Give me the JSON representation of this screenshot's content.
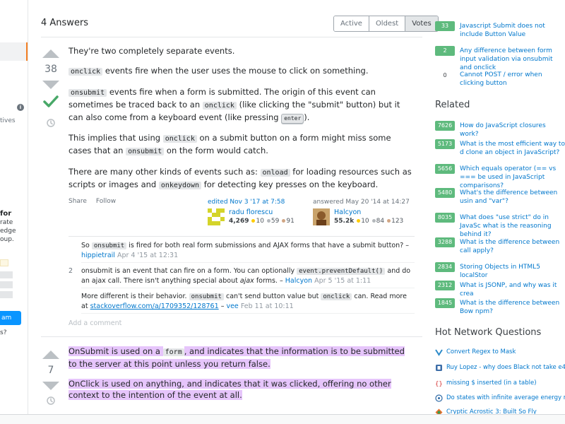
{
  "left_sidebar": {
    "label_tives": "tives",
    "label_for": "for",
    "line_rate": "rate",
    "line_edge": "edge",
    "line_oup": "oup.",
    "button_label": "am",
    "line_s": "s?"
  },
  "answers": {
    "count_label": "4 Answers",
    "sort_tabs": [
      {
        "label": "Active"
      },
      {
        "label": "Oldest"
      },
      {
        "label": "Votes"
      }
    ]
  },
  "answer1": {
    "votes": "38",
    "p1": "They're two completely separate events.",
    "p2_code": "onclick",
    "p2_rest": "events fire when the user uses the mouse to click on something.",
    "p3_code1": "onsubmit",
    "p3_text1": "events fire when a form is submitted. The origin of this event can sometimes be traced back to an",
    "p3_code2": "onclick",
    "p3_text2": "(like clicking the \"submit\" button) but it can also come from a keyboard event (like pressing",
    "p3_kbd": "enter",
    "p3_text3": ").",
    "p4_text1": "This implies that using",
    "p4_code1": "onclick",
    "p4_text2": "on a submit button on a form might miss some cases that an",
    "p4_code2": "onsubmit",
    "p4_text3": "on the form would catch.",
    "p5_text1": "There are many other kinds of events such as:",
    "p5_code1": "onload",
    "p5_text2": "for loading resources such as scripts or images and",
    "p5_code2": "onkeydown",
    "p5_text3": "for detecting key presses on the keyboard.",
    "menu_share": "Share",
    "menu_follow": "Follow",
    "editor": {
      "action": "edited Nov 3 '17 at 7:58",
      "name": "radu florescu",
      "rep": "4,269",
      "gold": "10",
      "silver": "59",
      "bronze": "91"
    },
    "author": {
      "action": "answered May 20 '14 at 14:27",
      "name": "Halcyon",
      "rep": "55.2k",
      "gold": "10",
      "silver": "84",
      "bronze": "123"
    }
  },
  "comments": [
    {
      "score": "",
      "t1": "So",
      "code1": "onsubmit",
      "t2": "is fired for both real form submissions and AJAX forms that have a submit button? –",
      "user": "hippietrail",
      "date": "Apr 4 '15 at 12:31"
    },
    {
      "score": "2",
      "t1": "onsubmit is an event that can fire on a form. You can optionally",
      "code1": "event.preventDefault()",
      "t2": "and do an ajax call. There isn't anything special about",
      "em": "ajax",
      "t3": "forms. –",
      "user": "Halcyon",
      "date": "Apr 5 '15 at 1:11"
    },
    {
      "score": "",
      "t1": "More different is their behavior.",
      "code1": "onsubmit",
      "t2": "can't send button value but",
      "code2": "onclick",
      "t3": "can. Read more at",
      "link": "stackoverflow.com/a/1709352/128761",
      "t4": "–",
      "user": "vee",
      "date": "Feb 11 at 10:11"
    }
  ],
  "add_comment": "Add a comment",
  "answer2": {
    "votes": "7",
    "p1_text1": "OnSubmit is used on a",
    "p1_code": "form",
    "p1_text2": ", and indicates that the information is to be submitted to the server at this point unless you return false.",
    "p2": "OnClick is used on anything, and indicates that it was clicked, offering no other context to the intention of the event at all."
  },
  "sidebar": {
    "linked": [
      {
        "count": "33",
        "text": "Javascript Submit does not include Button Value"
      },
      {
        "count": "2",
        "text": "Any difference between form input validation via onsubmit and onclick"
      },
      {
        "count": "0",
        "text": "Cannot POST / error when clicking button"
      }
    ],
    "related_title": "Related",
    "related": [
      {
        "count": "7626",
        "text": "How do JavaScript closures work?"
      },
      {
        "count": "5173",
        "text": "What is the most efficient way to d clone an object in JavaScript?"
      },
      {
        "count": "5656",
        "text": "Which equals operator (== vs === be used in JavaScript comparisons?"
      },
      {
        "count": "5480",
        "text": "What's the difference between usin and \"var\"?"
      },
      {
        "count": "8035",
        "text": "What does \"use strict\" do in JavaSc what is the reasoning behind it?"
      },
      {
        "count": "3288",
        "text": "What is the difference between call apply?"
      },
      {
        "count": "2834",
        "text": "Storing Objects in HTML5 localStor"
      },
      {
        "count": "2312",
        "text": "What is JSONP, and why was it crea"
      },
      {
        "count": "1845",
        "text": "What is the difference between Bow npm?"
      }
    ],
    "hnq_title": "Hot Network Questions",
    "hnq": [
      {
        "icon": "superuser-icon",
        "text": "Convert Regex to Mask"
      },
      {
        "icon": "chess-icon",
        "text": "Ruy Lopez - why does Black not take e4?"
      },
      {
        "icon": "tex-icon",
        "text": "missing $ inserted (in a table)"
      },
      {
        "icon": "physics-icon",
        "text": "Do states with infinite average energy mak"
      },
      {
        "icon": "puzzling-icon",
        "text": "Cryptic Acrostic 3: Built So Fly"
      }
    ]
  },
  "colors": {
    "accent_orange": "#f48024",
    "accepted_green": "#48a868",
    "badge_green": "#5eba7d",
    "link_blue": "#0077cc",
    "highlight": "#e6c5fb",
    "gold": "#ffcc01",
    "silver": "#b4b8bc",
    "bronze": "#d1a684"
  }
}
